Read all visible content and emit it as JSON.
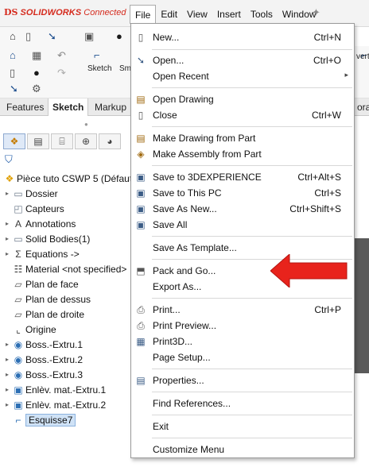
{
  "app": {
    "brand_logo": "DS",
    "brand_name": "SOLIDWORKS",
    "brand_suffix": "Connected",
    "brand_color": "#d52b1e"
  },
  "menubar": {
    "items": [
      "File",
      "Edit",
      "View",
      "Insert",
      "Tools",
      "Window"
    ],
    "active": "File"
  },
  "toolbar": {
    "sketch_label": "Sketch",
    "sm_label": "Sm",
    "right_cut_label": "vert"
  },
  "tabs": {
    "items": [
      "Features",
      "Sketch",
      "Markup",
      "ora"
    ],
    "active": "Sketch"
  },
  "feature_tree": {
    "root": "Pièce tuto CSWP 5 (Défaut)",
    "items": [
      {
        "label": "Dossier",
        "icon": "folder-icon"
      },
      {
        "label": "Capteurs",
        "icon": "sensor-icon"
      },
      {
        "label": "Annotations",
        "icon": "annotation-icon"
      },
      {
        "label": "Solid Bodies(1)",
        "icon": "solid-bodies-icon"
      },
      {
        "label": "Equations ->",
        "icon": "equation-icon"
      },
      {
        "label": "Material <not specified>",
        "icon": "material-icon"
      },
      {
        "label": "Plan de face",
        "icon": "plane-icon"
      },
      {
        "label": "Plan de dessus",
        "icon": "plane-icon"
      },
      {
        "label": "Plan de droite",
        "icon": "plane-icon"
      },
      {
        "label": "Origine",
        "icon": "origin-icon"
      },
      {
        "label": "Boss.-Extru.1",
        "icon": "boss-extrude-icon"
      },
      {
        "label": "Boss.-Extru.2",
        "icon": "boss-extrude-icon"
      },
      {
        "label": "Boss.-Extru.3",
        "icon": "boss-extrude-icon"
      },
      {
        "label": "Enlèv. mat.-Extru.1",
        "icon": "cut-extrude-icon"
      },
      {
        "label": "Enlèv. mat.-Extru.2",
        "icon": "cut-extrude-icon"
      },
      {
        "label": "Esquisse7",
        "icon": "sketch-icon",
        "selected": true
      }
    ]
  },
  "file_menu": {
    "items": [
      {
        "label": "New...",
        "shortcut": "Ctrl+N",
        "icon": "new-document-icon"
      },
      {
        "label": "Open...",
        "shortcut": "Ctrl+O",
        "icon": "open-arrow-icon"
      },
      {
        "label": "Open Recent",
        "shortcut": "",
        "icon": "",
        "submenu": true
      },
      {
        "label": "Open Drawing",
        "shortcut": "",
        "icon": "drawing-icon"
      },
      {
        "label": "Close",
        "shortcut": "Ctrl+W",
        "icon": "close-document-icon"
      },
      {
        "label": "Make Drawing from Part",
        "shortcut": "",
        "icon": "make-drawing-icon"
      },
      {
        "label": "Make Assembly from Part",
        "shortcut": "",
        "icon": "make-assembly-icon"
      },
      {
        "label": "Save to 3DEXPERIENCE",
        "shortcut": "Ctrl+Alt+S",
        "icon": "save-icon"
      },
      {
        "label": "Save to This PC",
        "shortcut": "Ctrl+S",
        "icon": "save-icon"
      },
      {
        "label": "Save As New...",
        "shortcut": "Ctrl+Shift+S",
        "icon": "save-as-icon"
      },
      {
        "label": "Save All",
        "shortcut": "",
        "icon": "save-all-icon"
      },
      {
        "label": "Save As Template...",
        "shortcut": "",
        "icon": ""
      },
      {
        "label": "Pack and Go...",
        "shortcut": "",
        "icon": "pack-and-go-icon"
      },
      {
        "label": "Export As...",
        "shortcut": "",
        "icon": ""
      },
      {
        "label": "Print...",
        "shortcut": "Ctrl+P",
        "icon": "print-icon"
      },
      {
        "label": "Print Preview...",
        "shortcut": "",
        "icon": "print-preview-icon"
      },
      {
        "label": "Print3D...",
        "shortcut": "",
        "icon": "print3d-icon"
      },
      {
        "label": "Page Setup...",
        "shortcut": "",
        "icon": ""
      },
      {
        "label": "Properties...",
        "shortcut": "",
        "icon": "properties-icon"
      },
      {
        "label": "Find References...",
        "shortcut": "",
        "icon": ""
      },
      {
        "label": "Exit",
        "shortcut": "",
        "icon": ""
      },
      {
        "label": "Customize Menu",
        "shortcut": "",
        "icon": ""
      }
    ]
  },
  "annotation": {
    "arrow_color": "#e8231c"
  }
}
